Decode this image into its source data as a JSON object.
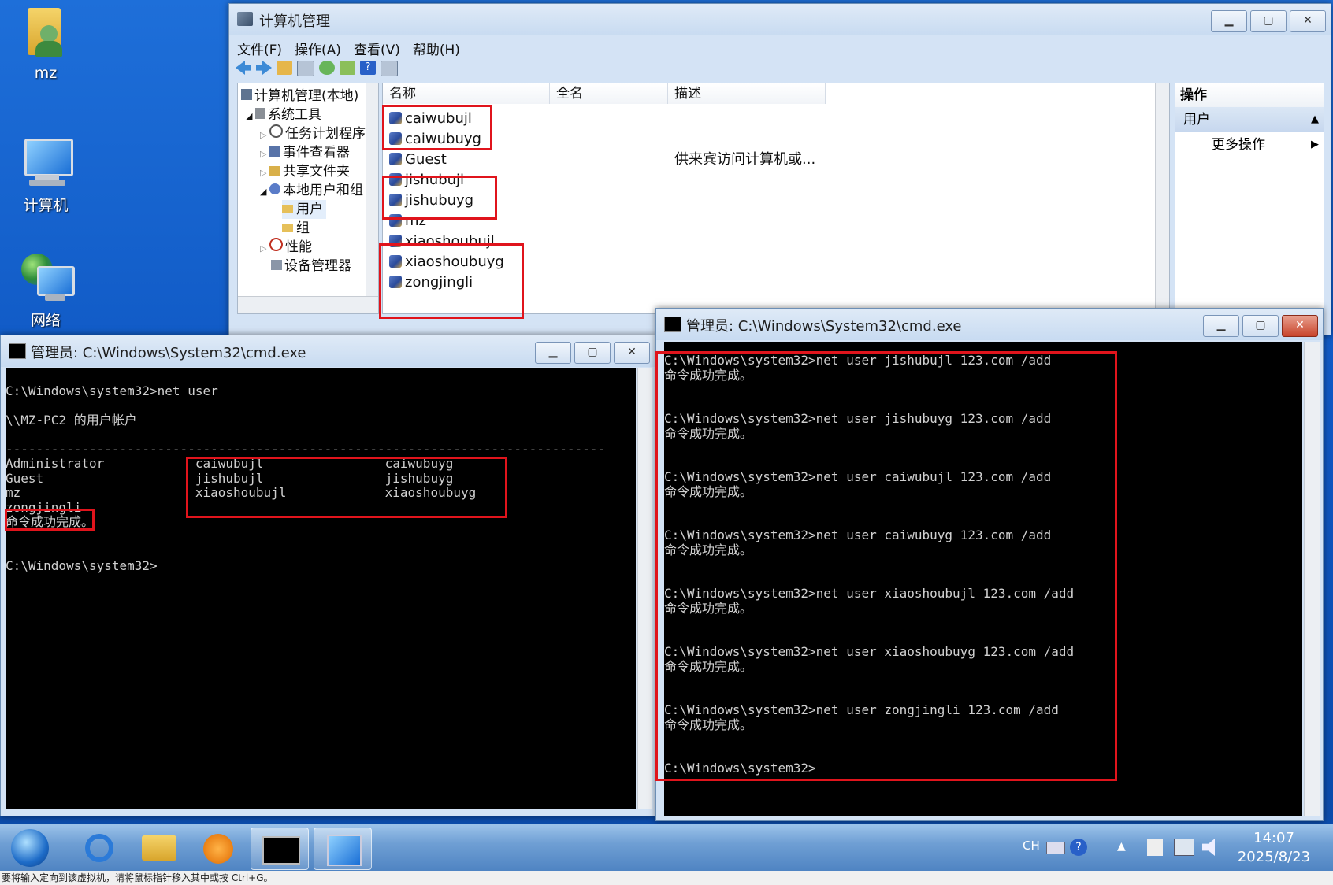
{
  "desktop": {
    "icons": [
      {
        "label": "mz",
        "icon": "user-folder-icon"
      },
      {
        "label": "计算机",
        "icon": "computer-icon"
      },
      {
        "label": "网络",
        "icon": "network-icon"
      }
    ]
  },
  "mgmt": {
    "title": "计算机管理",
    "menu": [
      "文件(F)",
      "操作(A)",
      "查看(V)",
      "帮助(H)"
    ],
    "tree": [
      {
        "label": "计算机管理(本地)",
        "level": 0
      },
      {
        "label": "系统工具",
        "level": 1
      },
      {
        "label": "任务计划程序",
        "level": 2
      },
      {
        "label": "事件查看器",
        "level": 2
      },
      {
        "label": "共享文件夹",
        "level": 2
      },
      {
        "label": "本地用户和组",
        "level": 2
      },
      {
        "label": "用户",
        "level": 3
      },
      {
        "label": "组",
        "level": 3
      },
      {
        "label": "性能",
        "level": 2
      },
      {
        "label": "设备管理器",
        "level": 2
      }
    ],
    "columns": [
      "名称",
      "全名",
      "描述"
    ],
    "users": [
      {
        "name": "caiwubujl",
        "desc": ""
      },
      {
        "name": "caiwubuyg",
        "desc": ""
      },
      {
        "name": "Guest",
        "desc": "供来宾访问计算机或..."
      },
      {
        "name": "jishubujl",
        "desc": ""
      },
      {
        "name": "jishubuyg",
        "desc": ""
      },
      {
        "name": "mz",
        "desc": ""
      },
      {
        "name": "xiaoshoubujl",
        "desc": ""
      },
      {
        "name": "xiaoshoubuyg",
        "desc": ""
      },
      {
        "name": "zongjingli",
        "desc": ""
      }
    ],
    "actions": {
      "header": "操作",
      "section": "用户",
      "more": "更多操作"
    }
  },
  "cmd_left": {
    "title": "管理员: C:\\Windows\\System32\\cmd.exe",
    "lines": [
      "",
      "C:\\Windows\\system32>net user",
      "",
      "\\\\MZ-PC2 的用户帐户",
      "",
      "-------------------------------------------------------------------------------",
      "Administrator            caiwubujl                caiwubuyg",
      "Guest                    jishubujl                jishubuyg",
      "mz                       xiaoshoubujl             xiaoshoubuyg",
      "zongjingli",
      "命令成功完成。",
      "",
      "",
      "C:\\Windows\\system32>"
    ]
  },
  "cmd_right": {
    "title": "管理员: C:\\Windows\\System32\\cmd.exe",
    "lines": [
      "C:\\Windows\\system32>net user jishubujl 123.com /add",
      "命令成功完成。",
      "",
      "",
      "C:\\Windows\\system32>net user jishubuyg 123.com /add",
      "命令成功完成。",
      "",
      "",
      "C:\\Windows\\system32>net user caiwubujl 123.com /add",
      "命令成功完成。",
      "",
      "",
      "C:\\Windows\\system32>net user caiwubuyg 123.com /add",
      "命令成功完成。",
      "",
      "",
      "C:\\Windows\\system32>net user xiaoshoubujl 123.com /add",
      "命令成功完成。",
      "",
      "",
      "C:\\Windows\\system32>net user xiaoshoubuyg 123.com /add",
      "命令成功完成。",
      "",
      "",
      "C:\\Windows\\system32>net user zongjingli 123.com /add",
      "命令成功完成。",
      "",
      "",
      "C:\\Windows\\system32>"
    ]
  },
  "taskbar": {
    "lang": "CH",
    "time": "14:07",
    "date": "2025/8/23"
  },
  "statusbar": {
    "text": "要将输入定向到该虚拟机，请将鼠标指针移入其中或按 Ctrl+G。"
  },
  "colors": {
    "highlight": "#e0141c",
    "console_bg": "#000000",
    "desktop": "#0f58c4"
  }
}
